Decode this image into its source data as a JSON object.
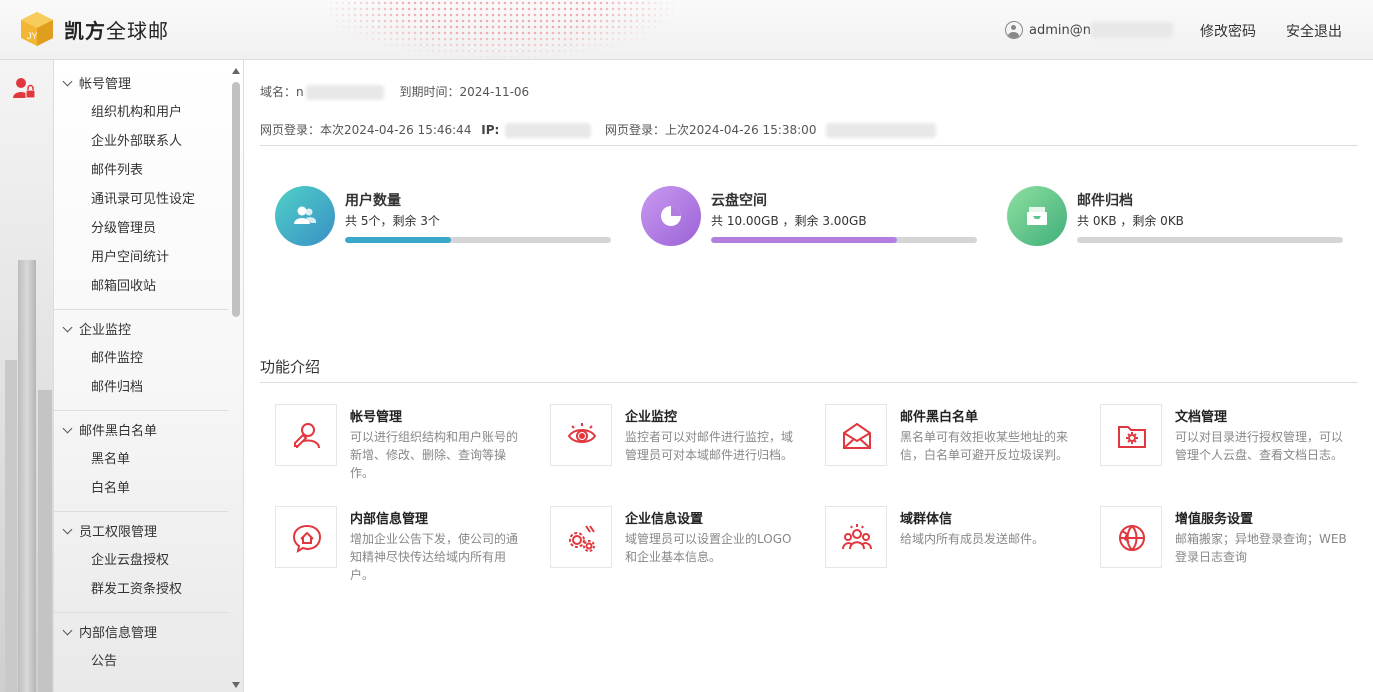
{
  "header": {
    "brand_bold": "凯方",
    "brand_rest": "全球邮",
    "user": "admin@n",
    "change_password": "修改密码",
    "logout": "安全退出"
  },
  "sidebar": {
    "groups": [
      {
        "title": "帐号管理",
        "items": [
          "组织机构和用户",
          "企业外部联系人",
          "邮件列表",
          "通讯录可见性设定",
          "分级管理员",
          "用户空间统计",
          "邮箱回收站"
        ]
      },
      {
        "title": "企业监控",
        "items": [
          "邮件监控",
          "邮件归档"
        ]
      },
      {
        "title": "邮件黑白名单",
        "items": [
          "黑名单",
          "白名单"
        ]
      },
      {
        "title": "员工权限管理",
        "items": [
          "企业云盘授权",
          "群发工资条授权"
        ]
      },
      {
        "title": "内部信息管理",
        "items": [
          "公告"
        ]
      }
    ]
  },
  "info": {
    "domain_label": "域名：",
    "domain_value": "n",
    "expire": "到期时间：2024-11-06",
    "login_current": "网页登录：本次2024-04-26 15:46:44",
    "ip_label": "IP:",
    "login_last": "网页登录：上次2024-04-26 15:38:00"
  },
  "stats": [
    {
      "title": "用户数量",
      "sub": "共 5个，剩余 3个",
      "progress": 0.4,
      "color": "#3ba7c9",
      "icon": "users-icon"
    },
    {
      "title": "云盘空间",
      "sub": "共 10.00GB ，剩余 3.00GB",
      "progress": 0.7,
      "color": "#b27fe0",
      "icon": "pie-chart-icon"
    },
    {
      "title": "邮件归档",
      "sub": "共 0KB ，剩余 0KB",
      "progress": 0.0,
      "color": "#5cc48e",
      "icon": "inbox-icon"
    }
  ],
  "features_title": "功能介绍",
  "features": [
    {
      "title": "帐号管理",
      "desc": "可以进行组织结构和用户账号的新增、修改、删除、查询等操作。",
      "icon": "user-edit-icon"
    },
    {
      "title": "企业监控",
      "desc": "监控者可以对邮件进行监控，域管理员可对本域邮件进行归档。",
      "icon": "eye-icon"
    },
    {
      "title": "邮件黑白名单",
      "desc": "黑名单可有效拒收某些地址的来信，白名单可避开反垃圾误判。",
      "icon": "mail-icon"
    },
    {
      "title": "文档管理",
      "desc": "可以对目录进行授权管理，可以管理个人云盘、查看文档日志。",
      "icon": "folder-gear-icon"
    },
    {
      "title": "内部信息管理",
      "desc": "增加企业公告下发，使公司的通知精神尽快传达给域内所有用户。",
      "icon": "chat-home-icon"
    },
    {
      "title": "企业信息设置",
      "desc": "域管理员可以设置企业的LOGO和企业基本信息。",
      "icon": "gears-icon"
    },
    {
      "title": "域群体信",
      "desc": "给域内所有成员发送邮件。",
      "icon": "group-icon"
    },
    {
      "title": "增值服务设置",
      "desc": "邮箱搬家；异地登录查询；WEB登录日志查询",
      "icon": "globe-icon"
    }
  ],
  "colors": {
    "accent_red": "#e0383e"
  }
}
